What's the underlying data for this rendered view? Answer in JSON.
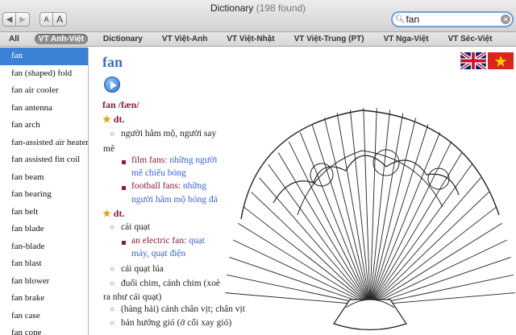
{
  "window": {
    "title": "Dictionary",
    "count": "(198 found)"
  },
  "toolbar": {
    "back_icon": "back-arrow-icon",
    "forward_icon": "forward-arrow-icon",
    "font_small": "A",
    "font_large": "A"
  },
  "search": {
    "value": "fan",
    "placeholder": ""
  },
  "scopes": [
    "All",
    "VT Anh-Việt",
    "Dictionary",
    "VT Việt-Anh",
    "VT Việt-Nhật",
    "VT Việt-Trung (PT)",
    "VT Nga-Việt",
    "VT Séc-Việt"
  ],
  "active_scope": "VT Anh-Việt",
  "sidebar": {
    "items": [
      "fan",
      "fan (shaped) fold",
      "fan air cooler",
      "fan antenna",
      "fan arch",
      "fan-assisted air heater",
      "fan assisted fin coil",
      "fan beam",
      "fan bearing",
      "fan belt",
      "fan blade",
      "fan-blade",
      "fan blast",
      "fan blower",
      "fan brake",
      "fan case",
      "fan cone"
    ],
    "selected_index": 0
  },
  "entry": {
    "headword": "fan",
    "pronunciation": "fan /fæn/",
    "pos1": "dt.",
    "pos2": "dt.",
    "sense1_line1": "người hâm mộ, người say",
    "sense1_line2": "mê",
    "ex1_en": "film fans:",
    "ex1_vi_a": "những người",
    "ex1_vi_b": "mê chiếu bóng",
    "ex2_en": "football fans:",
    "ex2_vi_a": "những",
    "ex2_vi_b": "người hâm mộ bóng đá",
    "sense2": "cái quạt",
    "ex3_en": "an electric fan:",
    "ex3_vi_a": "quạt",
    "ex3_vi_b": "máy, quạt điện",
    "sense3": "cái quạt lúa",
    "sense4_line1": "đuổi chim, cánh chim (xoè",
    "sense4_line2": "ra như cái quạt)",
    "sense5": "(hàng hải) cánh chân vịt; chân vịt",
    "sense6": "bản hướng gió (ở cối xay gió)"
  },
  "colors": {
    "accent": "#3b82d6",
    "headword": "#3c6fb8",
    "english": "#8b1a3a",
    "vietnamese": "#3a63c9"
  }
}
